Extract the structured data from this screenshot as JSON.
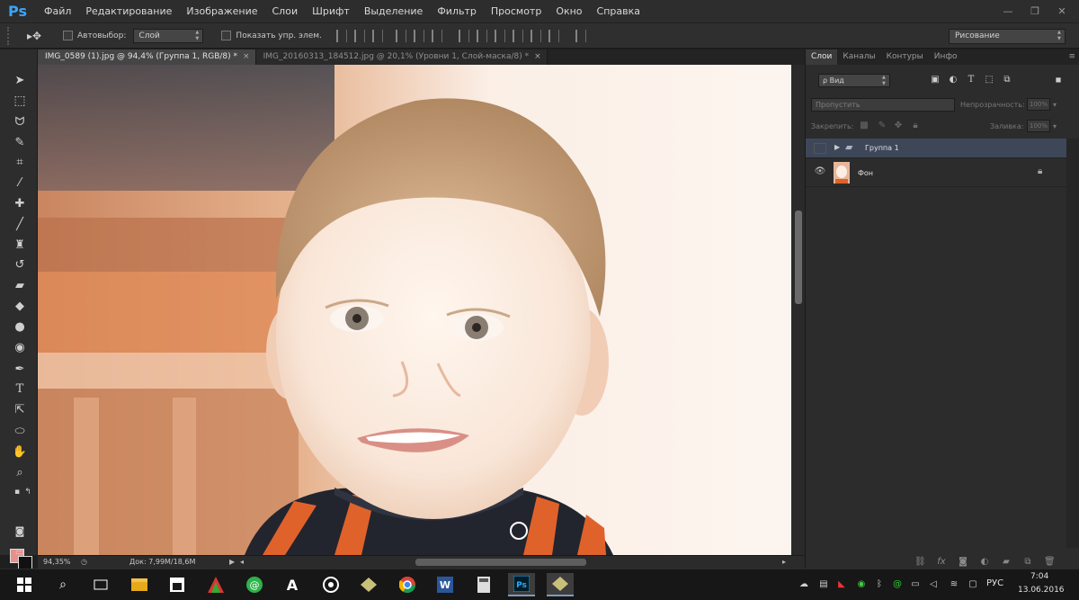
{
  "app": {
    "logo": "Ps",
    "menu": [
      "Файл",
      "Редактирование",
      "Изображение",
      "Слои",
      "Шрифт",
      "Выделение",
      "Фильтр",
      "Просмотр",
      "Окно",
      "Справка"
    ]
  },
  "window_controls": {
    "minimize": "—",
    "restore": "❐",
    "close": "✕"
  },
  "options_bar": {
    "tool_glyph": "▸✥",
    "autoselect_label": "Автовыбор:",
    "autoselect_value": "Слой",
    "show_controls_label": "Показать упр. элем.",
    "workspace": "Рисование"
  },
  "document_tabs": [
    {
      "title": "IMG_0589 (1).jpg @ 94,4% (Группа 1, RGB/8) *",
      "close": "×",
      "active": true
    },
    {
      "title": "IMG_20160313_184512.jpg @ 20,1% (Уровни 1, Слой-маска/8) *",
      "close": "×",
      "active": false
    }
  ],
  "status_bar": {
    "zoom": "94,35%",
    "doc_size": "Док: 7,99M/18,6M"
  },
  "layers_panel": {
    "tabs": [
      "Слои",
      "Каналы",
      "Контуры",
      "Инфо"
    ],
    "kind_filter": "ρ Вид",
    "blend_mode": "Пропустить",
    "opacity_label": "Непрозрачность:",
    "opacity_value": "100%",
    "lock_label": "Закрепить:",
    "fill_label": "Заливка:",
    "fill_value": "100%",
    "layers": [
      {
        "name": "Группа 1",
        "type": "group",
        "visible": false,
        "selected": true
      },
      {
        "name": "Фон",
        "type": "background",
        "visible": true,
        "locked": true
      }
    ]
  },
  "tools": [
    "move-tool",
    "marquee-tool",
    "lasso-tool",
    "quick-selection-tool",
    "crop-tool",
    "eyedropper-tool",
    "healing-brush-tool",
    "brush-tool",
    "clone-stamp-tool",
    "history-brush-tool",
    "eraser-tool",
    "paint-bucket-tool",
    "blur-tool",
    "dodge-tool",
    "pen-tool",
    "type-tool",
    "path-selection-tool",
    "ellipse-tool",
    "hand-tool",
    "zoom-tool"
  ],
  "colors": {
    "foreground": "#e98e88",
    "background": "#111111",
    "selection": "#3d4758"
  },
  "taskbar": {
    "language": "РУС",
    "time": "7:04",
    "date": "13.06.2016"
  }
}
